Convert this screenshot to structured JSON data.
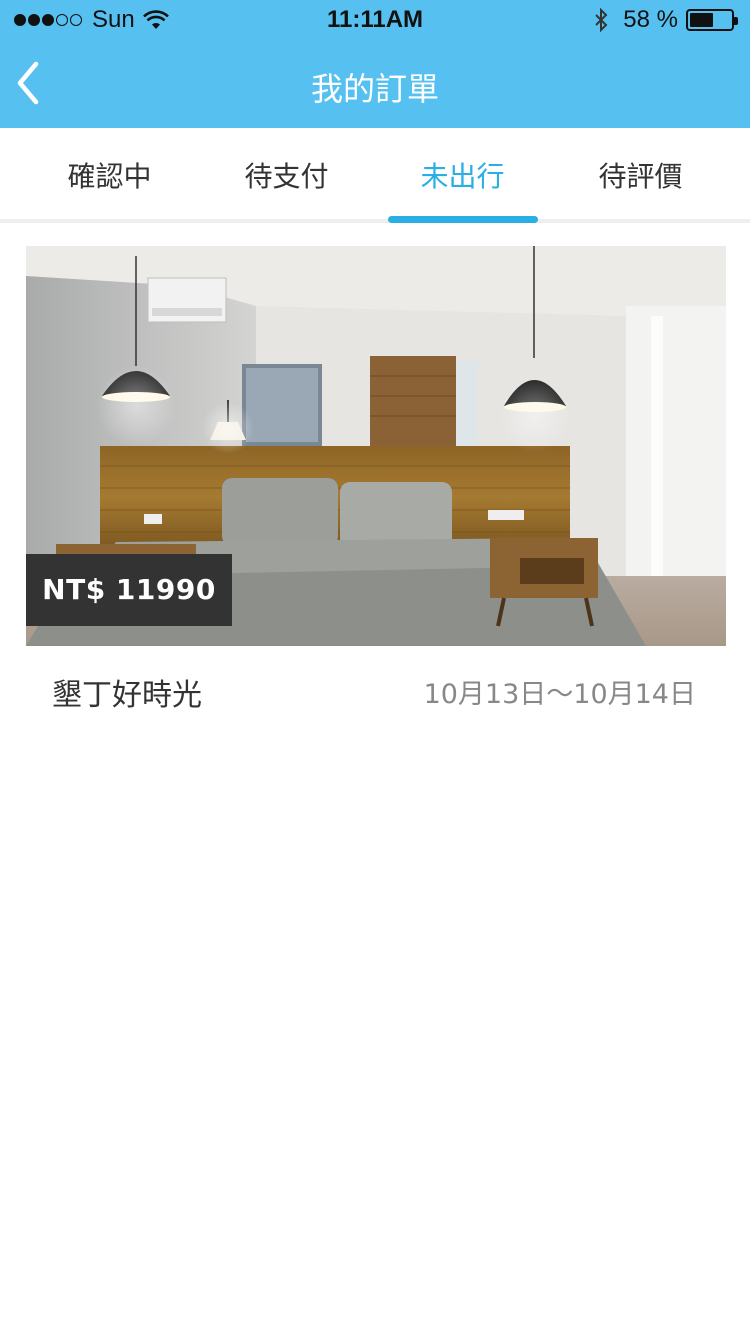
{
  "status_bar": {
    "carrier": "Sun",
    "time": "11:11AM",
    "battery_text": "58 %",
    "battery_level": 0.58,
    "signal_bars_filled": 3,
    "signal_bars_total": 5
  },
  "nav": {
    "title": "我的訂單",
    "back_icon": "chevron-left-icon"
  },
  "tabs": [
    {
      "label": "確認中",
      "active": false
    },
    {
      "label": "待支付",
      "active": false
    },
    {
      "label": "未出行",
      "active": true
    },
    {
      "label": "待評價",
      "active": false
    }
  ],
  "orders": [
    {
      "price": "NT$ 11990",
      "name": "墾丁好時光",
      "dates": "10月13日～10月14日"
    }
  ],
  "colors": {
    "header_bg": "#56c1f0",
    "accent": "#29aee6",
    "price_badge_bg": "#333333"
  }
}
